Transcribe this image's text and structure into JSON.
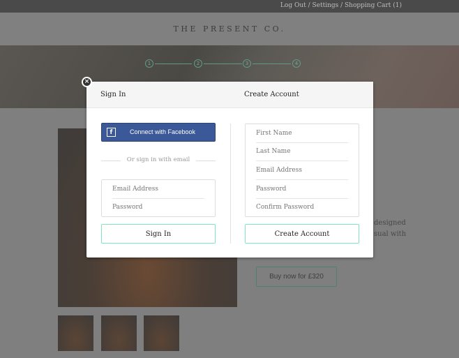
{
  "topbar": {
    "links": "Log Out / Settings / Shopping Cart (1)"
  },
  "header": {
    "logo": "THE PRESENT CO."
  },
  "steps": [
    "1",
    "2",
    "3",
    "4"
  ],
  "background": {
    "text_line1": "designed",
    "text_line2": "sual with",
    "buy_button": "Buy now for £320"
  },
  "modal": {
    "close_icon": "close-icon",
    "signin": {
      "title": "Sign In",
      "facebook_label": "Connect with Facebook",
      "facebook_icon": "facebook-icon",
      "divider": "Or sign in with email",
      "email_placeholder": "Email Address",
      "password_placeholder": "Password",
      "submit": "Sign In"
    },
    "create": {
      "title": "Create Account",
      "first_name_placeholder": "First Name",
      "last_name_placeholder": "Last Name",
      "email_placeholder": "Email Address",
      "password_placeholder": "Password",
      "confirm_placeholder": "Confirm Password",
      "submit": "Create Account"
    }
  },
  "colors": {
    "facebook": "#3b5998",
    "accent": "#7fe6bd",
    "overlay": "#7f7f7f"
  }
}
